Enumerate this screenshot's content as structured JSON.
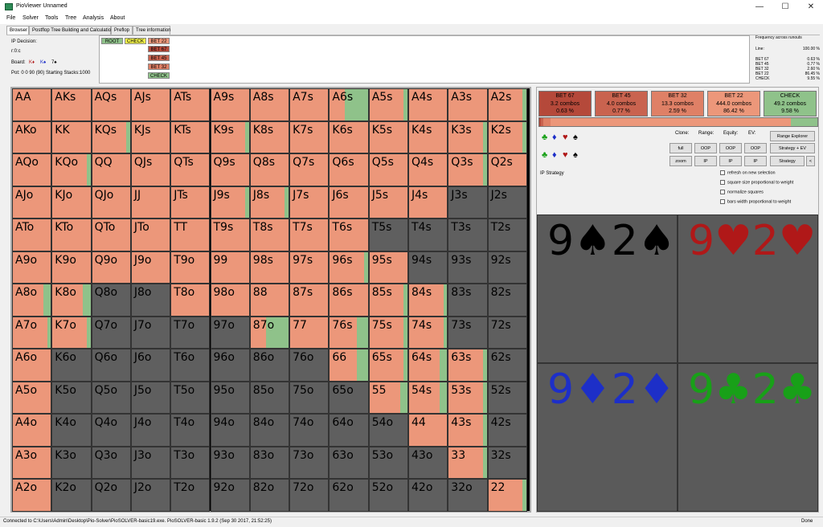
{
  "window": {
    "title": "PioViewer Unnamed",
    "minimize": "—",
    "maximize": "☐",
    "close": "✕"
  },
  "menu": [
    "File",
    "Solver",
    "Tools",
    "Tree",
    "Analysis",
    "About"
  ],
  "tabs": [
    "Browser",
    "Postflop Tree Building and Calculations",
    "Preflop",
    "Tree information"
  ],
  "info": {
    "decision": "IP Decision:",
    "line": "r:0:c",
    "board_label": "Board:",
    "board": [
      "K♦",
      "K♠",
      "7♠"
    ],
    "pot": "Pot: 0 0 90 (90) Starting Stacks:1000"
  },
  "tree": {
    "root": "ROOT",
    "check": "CHECK",
    "bets": [
      "BET 22",
      "BET 67",
      "BET 45",
      "BET 32"
    ],
    "check2": "CHECK"
  },
  "freq": {
    "title": "Frequency across runouts",
    "rows": [
      [
        "Line:",
        "100.00 %"
      ],
      [
        "BET 67",
        "0.63 %"
      ],
      [
        "BET 45",
        "0.77 %"
      ],
      [
        "BET 32",
        "2.60 %"
      ],
      [
        "BET 22",
        "86.45 %"
      ],
      [
        "CHECK",
        "9.55 %"
      ]
    ]
  },
  "actions": [
    {
      "name": "BET 67",
      "combos": "3.2 combos",
      "pct": "0.63 %",
      "color": "#b5493a"
    },
    {
      "name": "BET 45",
      "combos": "4.0 combos",
      "pct": "0.77 %",
      "color": "#c9634f"
    },
    {
      "name": "BET 32",
      "combos": "13.3 combos",
      "pct": "2.59 %",
      "color": "#df8066"
    },
    {
      "name": "BET 22",
      "combos": "444.0 combos",
      "pct": "86.42 %",
      "color": "#ec977a"
    },
    {
      "name": "CHECK",
      "combos": "49.2 combos",
      "pct": "9.58 %",
      "color": "#8fc28a"
    }
  ],
  "strategy_bar": [
    0.63,
    0.77,
    2.59,
    86.42,
    9.58
  ],
  "controls": {
    "clone": "Clone:",
    "range": "Range:",
    "equity": "Equity:",
    "ev": "EV:",
    "full": "full",
    "zoom": "zoom",
    "oop": "OOP",
    "ip": "IP",
    "range_explorer": "Range Explorer",
    "strategy_ev": "Strategy + EV",
    "strategy": "Strategy",
    "arrow": "<",
    "ip_strategy": "IP Strategy"
  },
  "checkboxes": [
    "refresh on new selection",
    "square size proportional to weight",
    "normalize squares",
    "bars width proportional to weight"
  ],
  "suit_squares": [
    {
      "text": "9♠2♠",
      "color": "#000000"
    },
    {
      "text": "9♥2♥",
      "color": "#b01818"
    },
    {
      "text": "9♦2♦",
      "color": "#1d2fc8"
    },
    {
      "text": "9♣2♣",
      "color": "#18a018"
    }
  ],
  "colors": {
    "bet": "#ec977a",
    "check": "#8fc28a",
    "empty": "#5f5f5f"
  },
  "grid": [
    [
      "AA",
      "AKs",
      "AQs",
      "AJs",
      "ATs",
      "A9s",
      "A8s",
      "A7s",
      "A6s",
      "A5s",
      "A4s",
      "A3s",
      "A2s"
    ],
    [
      "AKo",
      "KK",
      "KQs",
      "KJs",
      "KTs",
      "K9s",
      "K8s",
      "K7s",
      "K6s",
      "K5s",
      "K4s",
      "K3s",
      "K2s"
    ],
    [
      "AQo",
      "KQo",
      "QQ",
      "QJs",
      "QTs",
      "Q9s",
      "Q8s",
      "Q7s",
      "Q6s",
      "Q5s",
      "Q4s",
      "Q3s",
      "Q2s"
    ],
    [
      "AJo",
      "KJo",
      "QJo",
      "JJ",
      "JTs",
      "J9s",
      "J8s",
      "J7s",
      "J6s",
      "J5s",
      "J4s",
      "J3s",
      "J2s"
    ],
    [
      "ATo",
      "KTo",
      "QTo",
      "JTo",
      "TT",
      "T9s",
      "T8s",
      "T7s",
      "T6s",
      "T5s",
      "T4s",
      "T3s",
      "T2s"
    ],
    [
      "A9o",
      "K9o",
      "Q9o",
      "J9o",
      "T9o",
      "99",
      "98s",
      "97s",
      "96s",
      "95s",
      "94s",
      "93s",
      "92s"
    ],
    [
      "A8o",
      "K8o",
      "Q8o",
      "J8o",
      "T8o",
      "98o",
      "88",
      "87s",
      "86s",
      "85s",
      "84s",
      "83s",
      "82s"
    ],
    [
      "A7o",
      "K7o",
      "Q7o",
      "J7o",
      "T7o",
      "97o",
      "87o",
      "77",
      "76s",
      "75s",
      "74s",
      "73s",
      "72s"
    ],
    [
      "A6o",
      "K6o",
      "Q6o",
      "J6o",
      "T6o",
      "96o",
      "86o",
      "76o",
      "66",
      "65s",
      "64s",
      "63s",
      "62s"
    ],
    [
      "A5o",
      "K5o",
      "Q5o",
      "J5o",
      "T5o",
      "95o",
      "85o",
      "75o",
      "65o",
      "55",
      "54s",
      "53s",
      "52s"
    ],
    [
      "A4o",
      "K4o",
      "Q4o",
      "J4o",
      "T4o",
      "94o",
      "84o",
      "74o",
      "64o",
      "54o",
      "44",
      "43s",
      "42s"
    ],
    [
      "A3o",
      "K3o",
      "Q3o",
      "J3o",
      "T3o",
      "93o",
      "83o",
      "73o",
      "63o",
      "53o",
      "43o",
      "33",
      "32s"
    ],
    [
      "A2o",
      "K2o",
      "Q2o",
      "J2o",
      "T2o",
      "92o",
      "82o",
      "72o",
      "62o",
      "52o",
      "42o",
      "32o",
      "22"
    ]
  ],
  "check_fraction": [
    [
      0,
      0,
      0,
      0,
      0,
      0,
      0,
      0,
      0.6,
      0.1,
      0,
      0,
      0.1
    ],
    [
      0,
      0,
      0.1,
      0,
      0,
      0.1,
      0,
      0,
      0,
      0,
      0,
      0.1,
      0.1
    ],
    [
      0,
      0.1,
      0,
      0,
      0,
      0,
      0,
      0,
      0,
      0,
      0,
      0.1,
      0
    ],
    [
      0,
      0,
      0,
      0,
      0,
      0.1,
      0.1,
      0,
      0,
      0,
      0,
      null,
      null
    ],
    [
      0,
      0,
      0,
      0,
      0,
      0,
      0,
      0,
      0,
      null,
      null,
      null,
      null
    ],
    [
      0,
      0,
      0,
      0,
      0,
      0,
      0,
      0,
      0.1,
      0,
      null,
      null,
      null
    ],
    [
      0.2,
      0.2,
      null,
      null,
      0,
      0,
      0,
      0,
      0,
      0.1,
      0.1,
      null,
      null
    ],
    [
      0.1,
      0.1,
      null,
      null,
      null,
      null,
      0.6,
      0,
      0.3,
      0.1,
      0.1,
      null,
      null
    ],
    [
      0,
      null,
      null,
      null,
      null,
      null,
      null,
      null,
      0.3,
      0.1,
      0.2,
      0.1,
      null
    ],
    [
      0,
      null,
      null,
      null,
      null,
      null,
      null,
      null,
      null,
      0.2,
      0.2,
      0.1,
      null
    ],
    [
      0,
      null,
      null,
      null,
      null,
      null,
      null,
      null,
      null,
      null,
      0,
      0.1,
      null
    ],
    [
      0,
      null,
      null,
      null,
      null,
      null,
      null,
      null,
      null,
      null,
      null,
      0.1,
      null
    ],
    [
      0,
      null,
      null,
      null,
      null,
      null,
      null,
      null,
      null,
      null,
      null,
      null,
      0.1
    ]
  ],
  "status": {
    "left": "Connected to C:\\Users\\Admin\\Desktop\\Pio-Solver\\PioSOLVER-basic19.exe. PioSOLVER-basic 1.9.2 (Sep 30 2017, 21:52:25)",
    "right": "Done"
  }
}
